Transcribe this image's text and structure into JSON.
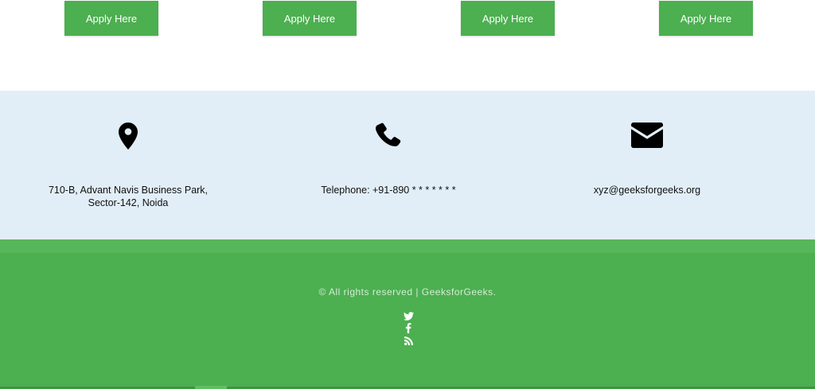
{
  "apply": {
    "buttons": [
      {
        "label": "Apply Here"
      },
      {
        "label": "Apply Here"
      },
      {
        "label": "Apply Here"
      },
      {
        "label": "Apply Here"
      }
    ]
  },
  "contact": {
    "address": {
      "icon": "map-marker-icon",
      "line1": "710-B, Advant Navis Business Park,",
      "line2": "Sector-142, Noida"
    },
    "phone": {
      "icon": "phone-icon",
      "text": "Telephone: +91-890 * * * * * * *"
    },
    "email": {
      "icon": "envelope-icon",
      "text": "xyz@geeksforgeeks.org"
    }
  },
  "footer": {
    "copyright": "© All rights reserved | GeeksforGeeks.",
    "social": [
      {
        "icon": "twitter-icon"
      },
      {
        "icon": "facebook-icon"
      },
      {
        "icon": "rss-icon"
      }
    ]
  },
  "colors": {
    "accent": "#4caf50",
    "contact_bg": "#e1eef8",
    "footer_text": "#d6ecd6"
  }
}
